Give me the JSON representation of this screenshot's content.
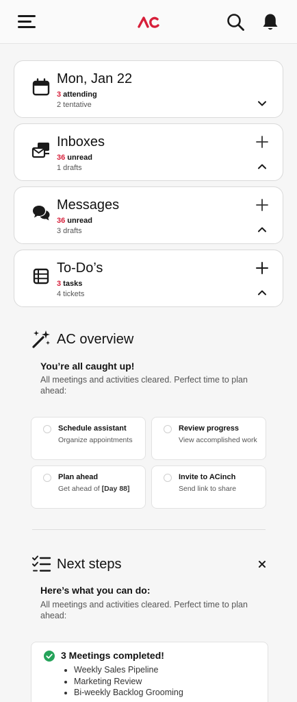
{
  "header": {
    "logo_text": "AC",
    "icons": [
      "hamburger-menu-icon",
      "search-icon",
      "bell-icon"
    ],
    "brand_color": "#d71f3a"
  },
  "cards": [
    {
      "title": "Mon, Jan 22",
      "count": "3",
      "count_label": " attending",
      "secondary": "2 tentative",
      "icon": "calendar-icon",
      "expanded": false
    },
    {
      "title": "Inboxes",
      "count": "36",
      "count_label": " unread",
      "secondary": "1 drafts",
      "icon": "inbox-stack-icon",
      "expanded": true
    },
    {
      "title": "Messages",
      "count": "36",
      "count_label": " unread",
      "secondary": "3 drafts",
      "icon": "chat-bubbles-icon",
      "expanded": true
    },
    {
      "title": "To-Do’s",
      "count": "3",
      "count_label": " tasks",
      "secondary": "4 tickets",
      "icon": "list-icon",
      "expanded": true
    }
  ],
  "overview": {
    "title": "AC overview",
    "subtitle": "You’re all caught up!",
    "description": "All meetings and activities cleared. Perfect time to plan ahead:",
    "actions": [
      {
        "title": "Schedule assistant",
        "subtitle": "Organize appointments"
      },
      {
        "title": "Review progress",
        "subtitle": "View accomplished work"
      },
      {
        "title": "Plan ahead",
        "subtitle_prefix": "Get ahead of ",
        "subtitle_bold": "[Day 88]"
      },
      {
        "title": "Invite to ACinch",
        "subtitle": "Send link to share"
      }
    ]
  },
  "next_steps": {
    "title": "Next steps",
    "subtitle": "Here’s what you can do:",
    "description": "All meetings and activities cleared. Perfect time to plan ahead:",
    "completed": {
      "title": "3 Meetings completed!",
      "items": [
        "Weekly Sales Pipeline",
        "Marketing Review",
        "Bi-weekly Backlog Grooming"
      ]
    }
  }
}
